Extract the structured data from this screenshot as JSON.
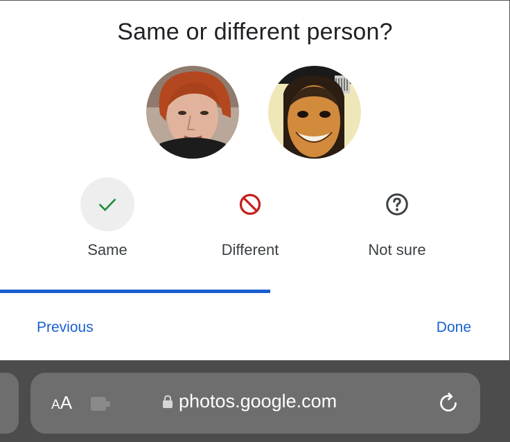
{
  "dialog": {
    "title": "Same or different person?",
    "faces": [
      {
        "name": "face-1"
      },
      {
        "name": "face-2"
      }
    ],
    "options": [
      {
        "label": "Same",
        "icon": "check-icon",
        "selected": true
      },
      {
        "label": "Different",
        "icon": "ban-icon",
        "selected": false
      },
      {
        "label": "Not sure",
        "icon": "question-icon",
        "selected": false
      }
    ],
    "progress_fraction": 0.53,
    "previous_label": "Previous",
    "done_label": "Done"
  },
  "browser": {
    "text_size_small": "A",
    "text_size_large": "A",
    "url": "photos.google.com",
    "icons": [
      "extension-icon",
      "lock-icon",
      "reload-icon"
    ]
  },
  "colors": {
    "accent": "#1a5fd0",
    "check": "#1e8e3e",
    "ban": "#c5221f",
    "question": "#3c4043",
    "toolbar": "#4c4c4c",
    "pill": "#6e6e6e"
  }
}
